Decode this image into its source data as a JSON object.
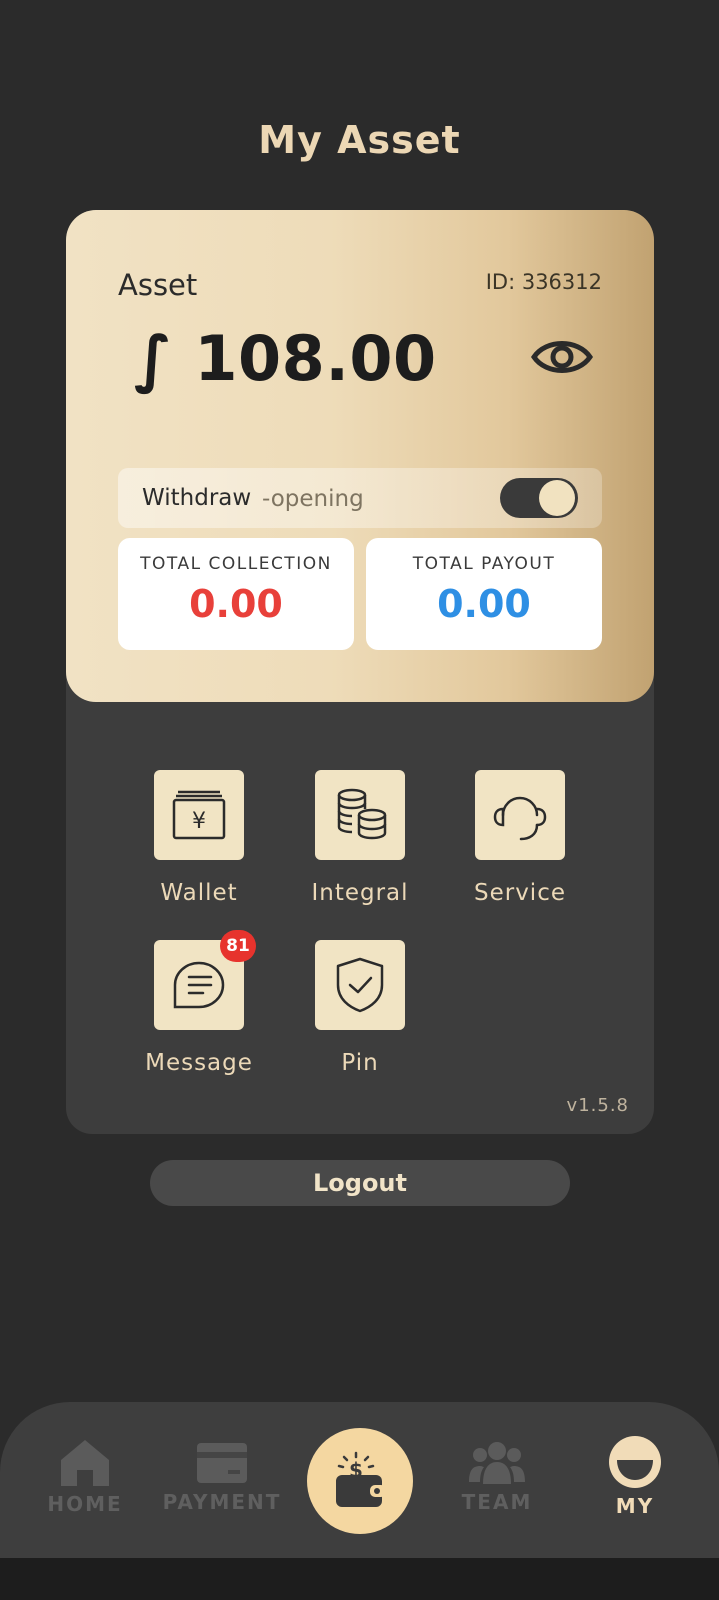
{
  "header": {
    "title": "My Asset"
  },
  "asset_card": {
    "label": "Asset",
    "id_text": "ID: 336312",
    "amount": "∫ 108.00",
    "withdraw_label": "Withdraw",
    "withdraw_status": "-opening",
    "withdraw_enabled": true,
    "total_collection": {
      "title": "TOTAL COLLECTION",
      "value": "0.00"
    },
    "total_payout": {
      "title": "TOTAL PAYOUT",
      "value": "0.00"
    }
  },
  "menu": {
    "items": [
      {
        "label": "Wallet",
        "icon": "wallet-yen-icon"
      },
      {
        "label": "Integral",
        "icon": "coins-icon"
      },
      {
        "label": "Service",
        "icon": "headset-icon"
      },
      {
        "label": "Message",
        "icon": "chat-bubble-icon",
        "badge": "81"
      },
      {
        "label": "Pin",
        "icon": "shield-check-icon"
      }
    ]
  },
  "version": "v1.5.8",
  "logout_label": "Logout",
  "bottom_nav": {
    "items": [
      {
        "label": "HOME",
        "icon": "home-icon"
      },
      {
        "label": "PAYMENT",
        "icon": "card-icon"
      },
      {
        "label": "",
        "icon": "wallet-money-icon"
      },
      {
        "label": "TEAM",
        "icon": "team-icon"
      },
      {
        "label": "MY",
        "icon": "profile-icon",
        "active": true
      }
    ]
  },
  "colors": {
    "background": "#2b2b2b",
    "accent_gold": "#ecd7b4",
    "collection_red": "#e8403a",
    "payout_blue": "#2e8fe4",
    "badge_red": "#e7332d"
  }
}
